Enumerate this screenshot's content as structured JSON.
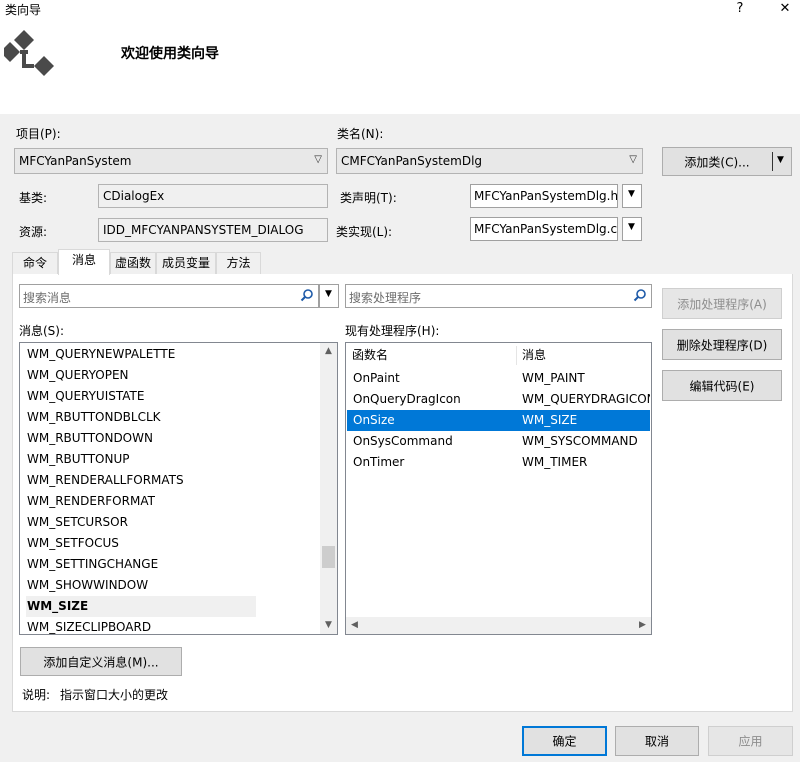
{
  "window": {
    "title": "类向导",
    "help_glyph": "?",
    "close_glyph": "✕"
  },
  "banner": {
    "title": "欢迎使用类向导",
    "icon": "class-wizard-icon"
  },
  "project": {
    "label": "项目(P):",
    "value": "MFCYanPanSystem"
  },
  "classname": {
    "label": "类名(N):",
    "value": "CMFCYanPanSystemDlg"
  },
  "add_class_button": {
    "label": "添加类(C)..."
  },
  "base_class": {
    "label": "基类:",
    "value": "CDialogEx"
  },
  "class_decl": {
    "label": "类声明(T):",
    "value": "MFCYanPanSystemDlg.h"
  },
  "resource": {
    "label": "资源:",
    "value": "IDD_MFCYANPANSYSTEM_DIALOG"
  },
  "class_impl": {
    "label": "类实现(L):",
    "value": "MFCYanPanSystemDlg.cpp"
  },
  "tabs": [
    {
      "label": "命令"
    },
    {
      "label": "消息"
    },
    {
      "label": "虚函数"
    },
    {
      "label": "成员变量"
    },
    {
      "label": "方法"
    }
  ],
  "search_messages": {
    "placeholder": "搜索消息"
  },
  "search_handlers": {
    "placeholder": "搜索处理程序"
  },
  "messages": {
    "label": "消息(S):",
    "items": [
      "WM_QUERYNEWPALETTE",
      "WM_QUERYOPEN",
      "WM_QUERYUISTATE",
      "WM_RBUTTONDBLCLK",
      "WM_RBUTTONDOWN",
      "WM_RBUTTONUP",
      "WM_RENDERALLFORMATS",
      "WM_RENDERFORMAT",
      "WM_SETCURSOR",
      "WM_SETFOCUS",
      "WM_SETTINGCHANGE",
      "WM_SHOWWINDOW",
      "WM_SIZE",
      "WM_SIZECLIPBOARD"
    ],
    "selected_index": 12
  },
  "handlers": {
    "label": "现有处理程序(H):",
    "columns": [
      "函数名",
      "消息"
    ],
    "rows": [
      [
        "OnPaint",
        "WM_PAINT"
      ],
      [
        "OnQueryDragIcon",
        "WM_QUERYDRAGICON"
      ],
      [
        "OnSize",
        "WM_SIZE"
      ],
      [
        "OnSysCommand",
        "WM_SYSCOMMAND"
      ],
      [
        "OnTimer",
        "WM_TIMER"
      ]
    ],
    "selected_index": 2
  },
  "side_buttons": {
    "add_handler": "添加处理程序(A)",
    "delete_handler": "删除处理程序(D)",
    "edit_code": "编辑代码(E)"
  },
  "add_custom_message": {
    "label": "添加自定义消息(M)..."
  },
  "description": {
    "label": "说明:",
    "text": "指示窗口大小的更改"
  },
  "footer": {
    "ok": "确定",
    "cancel": "取消",
    "apply": "应用"
  },
  "colors": {
    "accent": "#0078d7",
    "panel": "#f0f0f0",
    "selection": "#0078d7"
  }
}
